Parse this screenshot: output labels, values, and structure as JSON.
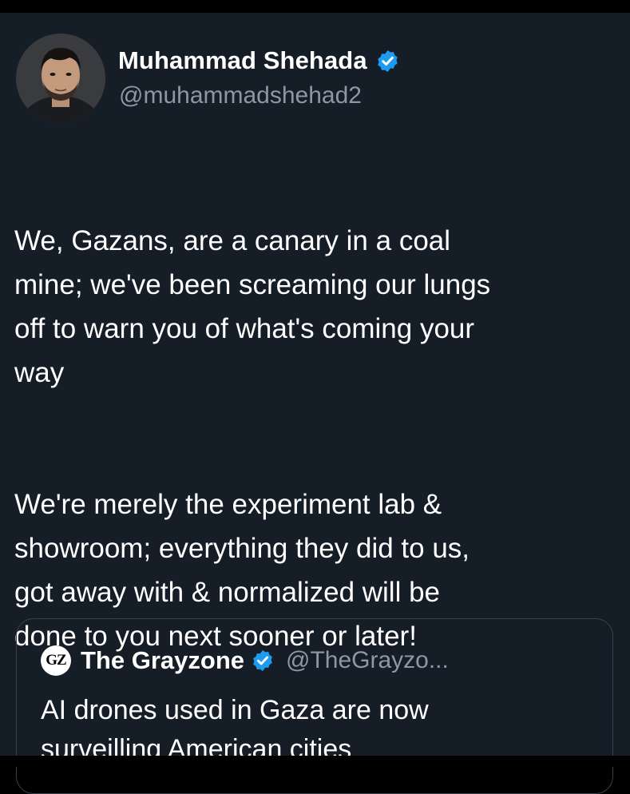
{
  "author": {
    "display_name": "Muhammad Shehada",
    "handle": "@muhammadshehad2",
    "verified_color": "#1d9bf0"
  },
  "tweet": {
    "paragraphs": [
      "We, Gazans, are a canary in a coal\nmine; we've been screaming our lungs\noff to warn you of what's coming your\nway",
      "We're merely the experiment lab &\nshowroom; everything they did to us,\ngot away with & normalized will be\ndone to you next sooner or later!"
    ]
  },
  "quoted_tweet": {
    "logo_text": "GZ",
    "display_name": "The Grayzone",
    "handle": "@TheGrayzo...",
    "text": "AI drones used in Gaza are now\nsurveilling American cities"
  },
  "colors": {
    "background": "#151d27",
    "text": "#ffffff",
    "secondary_text": "#8b98a5",
    "border": "#38444d",
    "accent": "#1d9bf0"
  },
  "icons": {
    "verified": "verified-badge-icon",
    "avatar": "profile-photo"
  }
}
